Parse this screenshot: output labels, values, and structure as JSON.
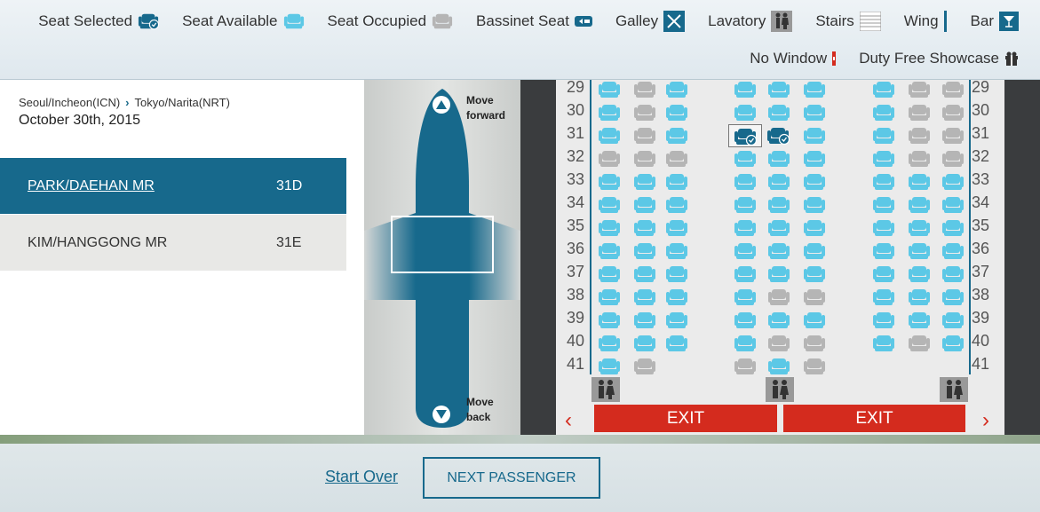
{
  "legend": {
    "row1": [
      {
        "label": "Seat Selected",
        "icon": "seat-selected-icon"
      },
      {
        "label": "Seat Available",
        "icon": "seat-available-icon"
      },
      {
        "label": "Seat Occupied",
        "icon": "seat-occupied-icon"
      },
      {
        "label": "Bassinet Seat",
        "icon": "bassinet-icon"
      },
      {
        "label": "Galley",
        "icon": "galley-icon"
      },
      {
        "label": "Lavatory",
        "icon": "lavatory-icon"
      },
      {
        "label": "Stairs",
        "icon": "stairs-icon"
      },
      {
        "label": "Wing",
        "icon": "wing-icon"
      },
      {
        "label": "Bar",
        "icon": "bar-icon"
      }
    ],
    "row2": [
      {
        "label": "No Window",
        "icon": "no-window-icon"
      },
      {
        "label": "Duty Free Showcase",
        "icon": "duty-free-icon"
      }
    ]
  },
  "flight": {
    "origin": "Seoul/Incheon(ICN)",
    "destination": "Tokyo/Narita(NRT)",
    "date": "October 30th, 2015"
  },
  "passengers": [
    {
      "name": "PARK/DAEHAN MR",
      "seat": "31D",
      "active": true
    },
    {
      "name": "KIM/HANGGONG MR",
      "seat": "31E",
      "active": false
    }
  ],
  "minimap": {
    "forward": "Move forward",
    "back": "Move back"
  },
  "seatmap": {
    "rows": [
      "29",
      "30",
      "31",
      "32",
      "33",
      "34",
      "35",
      "36",
      "37",
      "38",
      "39",
      "40",
      "41"
    ],
    "seat_states": [
      [
        "A",
        "O",
        "A",
        "A",
        "A",
        "A",
        "A",
        "O",
        "O"
      ],
      [
        "A",
        "O",
        "A",
        "A",
        "A",
        "A",
        "A",
        "O",
        "O"
      ],
      [
        "A",
        "O",
        "A",
        "S",
        "S",
        "A",
        "A",
        "O",
        "O"
      ],
      [
        "O",
        "O",
        "O",
        "A",
        "A",
        "A",
        "A",
        "O",
        "O"
      ],
      [
        "A",
        "A",
        "A",
        "A",
        "A",
        "A",
        "A",
        "A",
        "A"
      ],
      [
        "A",
        "A",
        "A",
        "A",
        "A",
        "A",
        "A",
        "A",
        "A"
      ],
      [
        "A",
        "A",
        "A",
        "A",
        "A",
        "A",
        "A",
        "A",
        "A"
      ],
      [
        "A",
        "A",
        "A",
        "A",
        "A",
        "A",
        "A",
        "A",
        "A"
      ],
      [
        "A",
        "A",
        "A",
        "A",
        "A",
        "A",
        "A",
        "A",
        "A"
      ],
      [
        "A",
        "A",
        "A",
        "A",
        "O",
        "O",
        "A",
        "A",
        "A"
      ],
      [
        "A",
        "A",
        "A",
        "A",
        "A",
        "A",
        "A",
        "A",
        "A"
      ],
      [
        "A",
        "A",
        "A",
        "A",
        "O",
        "O",
        "A",
        "O",
        "A"
      ],
      [
        "A",
        "O",
        "-",
        "O",
        "A",
        "O",
        "-",
        "-",
        "-"
      ]
    ],
    "exit_label": "EXIT",
    "colors": {
      "available": "#5cc8e6",
      "occupied": "#b5b5b5",
      "selected": "#17698c",
      "exit": "#d42b1e"
    }
  },
  "actions": {
    "start_over": "Start Over",
    "next": "NEXT PASSENGER"
  }
}
